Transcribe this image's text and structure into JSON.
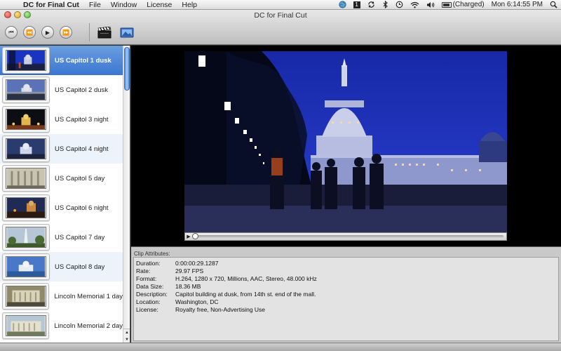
{
  "menubar": {
    "apple_glyph": "",
    "app_name": "DC for Final Cut",
    "items": [
      "File",
      "Window",
      "License",
      "Help"
    ],
    "status": {
      "num_badge": "1",
      "battery": "(Charged)",
      "clock": "Mon 6:14:55 PM"
    }
  },
  "window": {
    "title": "DC for Final Cut"
  },
  "toolbar": {
    "prev_glyph": "⏮",
    "rewind_glyph": "⏪",
    "play_glyph": "▶",
    "forward_glyph": "⏩"
  },
  "clips": [
    {
      "label": "US Capitol 1 dusk"
    },
    {
      "label": "US Capitol 2 dusk"
    },
    {
      "label": "US Capitol 3 night"
    },
    {
      "label": "US Capitol 4 night"
    },
    {
      "label": "US Capitol 5 day"
    },
    {
      "label": "US Capitol 6 night"
    },
    {
      "label": "US Capitol 7 day"
    },
    {
      "label": "US Capitol 8 day"
    },
    {
      "label": "Lincoln Memorial 1 day"
    },
    {
      "label": "Lincoln Memorial 2 day"
    }
  ],
  "scroll_arrows": "▲\n▼",
  "player": {
    "play_glyph": "▶",
    "progress": 0.0
  },
  "attributes": {
    "title": "Clip Attributes:",
    "rows": [
      {
        "key": "Duration:",
        "value": "0:00:00:29.1287"
      },
      {
        "key": "Rate:",
        "value": "29.97 FPS"
      },
      {
        "key": "Format:",
        "value": "H.264, 1280 x 720, Millions, AAC, Stereo, 48.000 kHz"
      },
      {
        "key": "Data Size:",
        "value": "18.36 MB"
      },
      {
        "key": "Description:",
        "value": "Capitol building at dusk, from 14th st. end of the mall."
      },
      {
        "key": "Location:",
        "value": "Washington, DC"
      },
      {
        "key": "License:",
        "value": "Royalty free, Non-Advertising Use"
      }
    ]
  },
  "colors": {
    "selection": "#3b76d0",
    "video_sky": "#1a2fb0"
  }
}
